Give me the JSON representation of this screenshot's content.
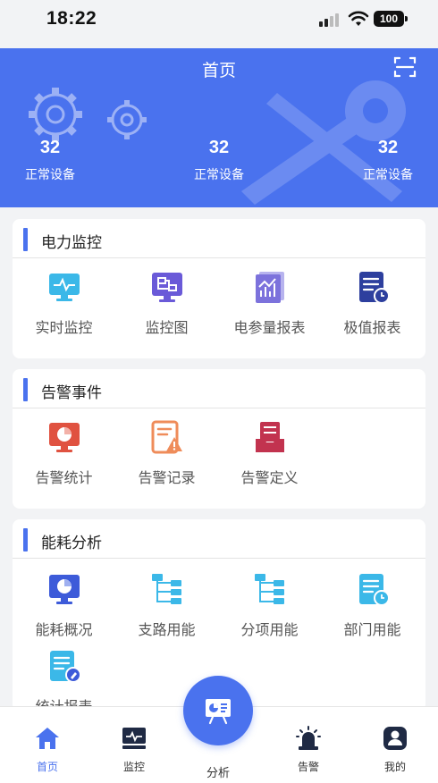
{
  "status_bar": {
    "time": "18:22",
    "battery": "100"
  },
  "header": {
    "title": "首页",
    "stats": [
      {
        "value": "32",
        "label": "正常设备"
      },
      {
        "value": "32",
        "label": "正常设备"
      },
      {
        "value": "32",
        "label": "正常设备"
      }
    ]
  },
  "sections": {
    "power": {
      "title": "电力监控",
      "items": [
        {
          "label": "实时监控",
          "icon": "monitor-pulse-icon"
        },
        {
          "label": "监控图",
          "icon": "monitor-diagram-icon"
        },
        {
          "label": "电参量报表",
          "icon": "chart-report-icon"
        },
        {
          "label": "极值报表",
          "icon": "document-clock-icon"
        }
      ]
    },
    "alarm": {
      "title": "告警事件",
      "items": [
        {
          "label": "告警统计",
          "icon": "monitor-pie-icon"
        },
        {
          "label": "告警记录",
          "icon": "document-warning-icon"
        },
        {
          "label": "告警定义",
          "icon": "inbox-stack-icon"
        }
      ]
    },
    "energy": {
      "title": "能耗分析",
      "items": [
        {
          "label": "能耗概况",
          "icon": "monitor-pie-icon"
        },
        {
          "label": "支路用能",
          "icon": "branch-tree-icon"
        },
        {
          "label": "分项用能",
          "icon": "branch-tree-icon"
        },
        {
          "label": "部门用能",
          "icon": "document-clock-icon"
        },
        {
          "label": "统计报表",
          "icon": "document-edit-icon"
        }
      ]
    }
  },
  "tabbar": {
    "home": "首页",
    "monitor": "监控",
    "analysis": "分析",
    "alarm": "告警",
    "mine": "我的"
  },
  "colors": {
    "primary": "#4a72ee",
    "icon_blue": "#3d5bd9",
    "icon_cyan": "#3bb8e8",
    "icon_purple": "#6a5ad8",
    "icon_red": "#e05240",
    "icon_orange": "#ef8c5a",
    "icon_crimson": "#c2334f"
  }
}
